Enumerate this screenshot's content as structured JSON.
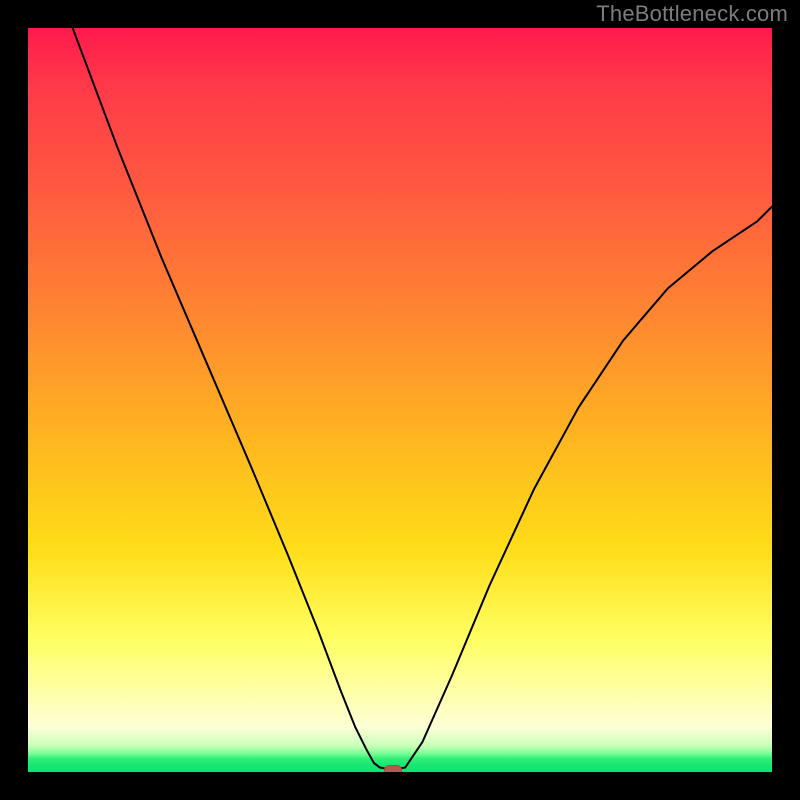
{
  "watermark": {
    "text": "TheBottleneck.com"
  },
  "chart_data": {
    "type": "line",
    "title": "",
    "xlabel": "",
    "ylabel": "",
    "xlim": [
      0,
      100
    ],
    "ylim": [
      0,
      100
    ],
    "grid": false,
    "legend": false,
    "colors": {
      "curve": "#000000",
      "gradient_top": "#ff1a4d",
      "gradient_mid": "#ffdd18",
      "gradient_bottom": "#10e070",
      "marker": "#b55a4e",
      "frame": "#000000"
    },
    "series": [
      {
        "name": "left-branch",
        "x": [
          6,
          12,
          18,
          24,
          30,
          35,
          39,
          42,
          44,
          45.5,
          46.5,
          47.3
        ],
        "y": [
          100,
          84,
          69,
          55,
          41,
          29,
          19,
          11,
          6,
          3,
          1.2,
          0.6
        ]
      },
      {
        "name": "valley-floor",
        "x": [
          47.3,
          49.0,
          50.7
        ],
        "y": [
          0.6,
          0.3,
          0.6
        ]
      },
      {
        "name": "right-branch",
        "x": [
          50.7,
          53,
          57,
          62,
          68,
          74,
          80,
          86,
          92,
          98,
          100
        ],
        "y": [
          0.6,
          4,
          13,
          25,
          38,
          49,
          58,
          65,
          70,
          74,
          76
        ]
      }
    ],
    "annotations": [
      {
        "name": "min-marker",
        "x": 49,
        "y": 0.3
      }
    ]
  }
}
